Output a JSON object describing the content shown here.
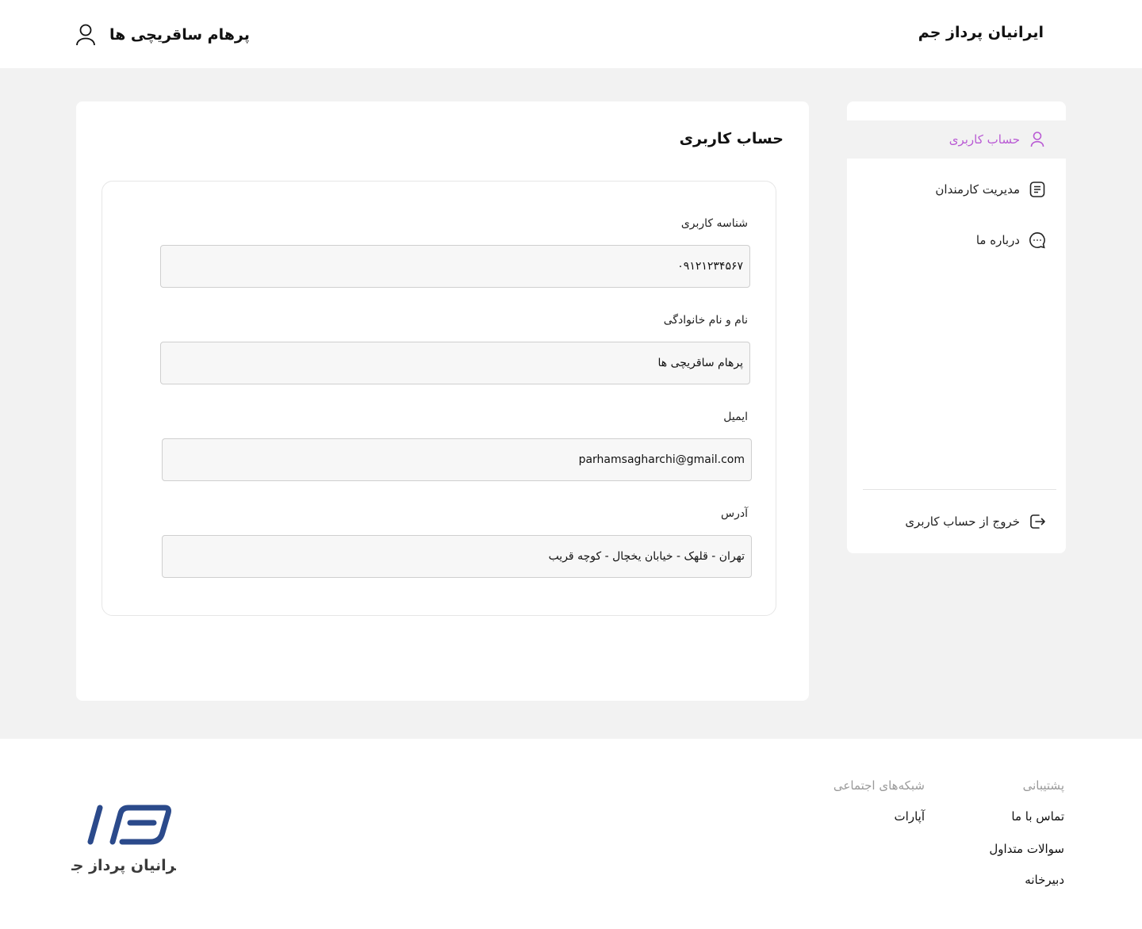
{
  "header": {
    "brand": "ایرانیان پرداز جم",
    "user_name": "پرهام ساقریچی ها"
  },
  "sidebar": {
    "items": [
      {
        "label": "حساب کاربری",
        "icon": "user-icon",
        "active": true
      },
      {
        "label": "مدیریت کارمندان",
        "icon": "document-list-icon",
        "active": false
      },
      {
        "label": "درباره ما",
        "icon": "chat-bubble-icon",
        "active": false
      }
    ],
    "logout_label": "خروج از حساب کاربری",
    "accent_color": "#b95ad4"
  },
  "content": {
    "title": "حساب کاربری",
    "fields": [
      {
        "label": "شناسه کاربری",
        "value": "۰۹۱۲۱۲۳۴۵۶۷"
      },
      {
        "label": "نام و نام خانوادگی",
        "value": "پرهام ساقریچی ها"
      },
      {
        "label": "ایمیل",
        "value": "parhamsagharchi@gmail.com"
      },
      {
        "label": "آدرس",
        "value": "تهران - قلهک - خیابان یخچال - کوچه قریب"
      }
    ]
  },
  "footer": {
    "support": {
      "title": "پشتیبانی",
      "links": [
        "تماس با ما",
        "سوالات متداول",
        "دبیرخانه"
      ]
    },
    "social": {
      "title": "شبکه‌های اجتماعی",
      "links": [
        "آپارات"
      ]
    },
    "logo_text": "ایرانیان پرداز جم",
    "logo_color": "#2b4a8b"
  }
}
